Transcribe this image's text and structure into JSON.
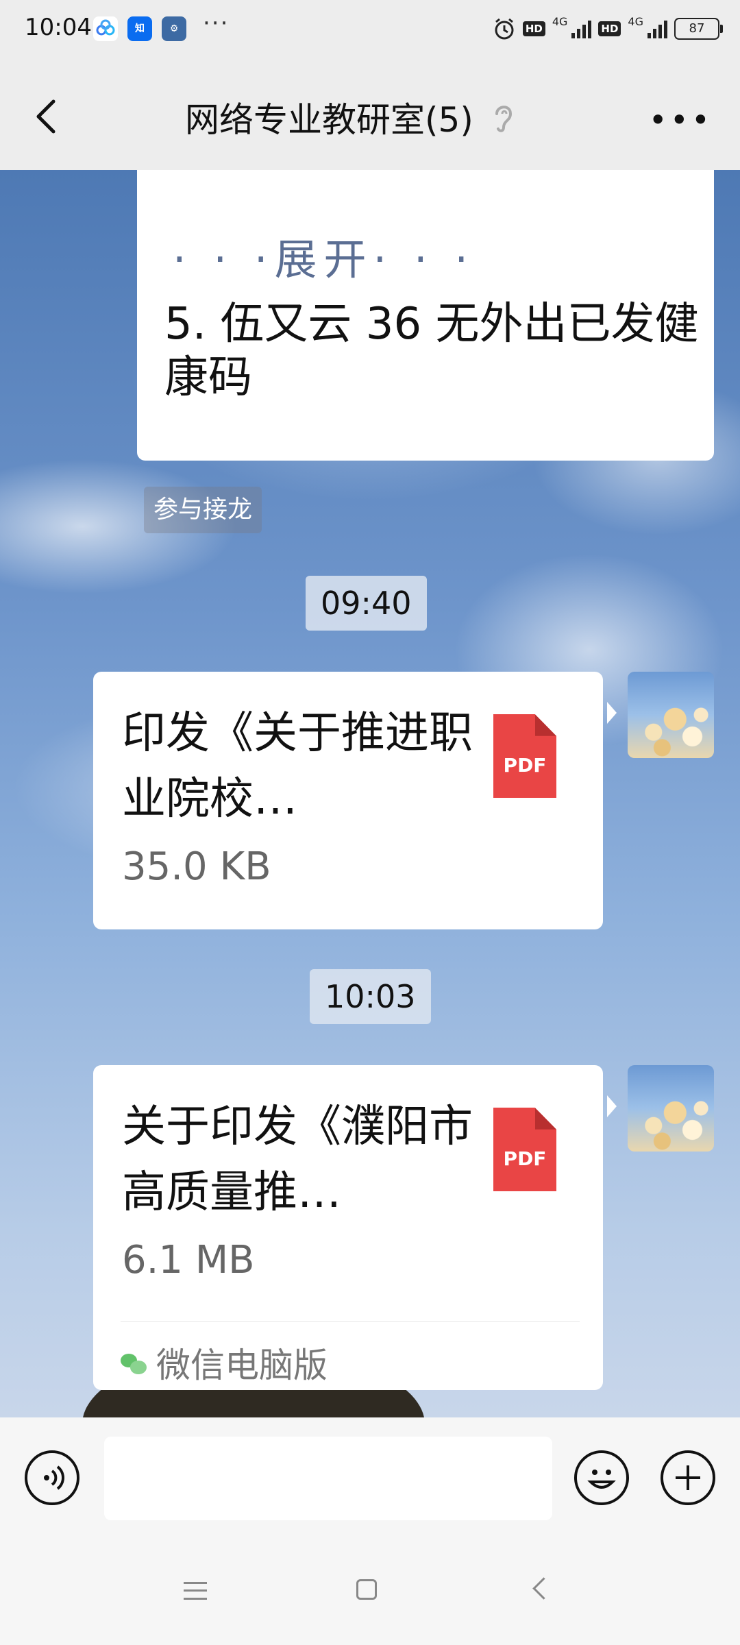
{
  "status_bar": {
    "time": "10:04",
    "apps": [
      "baidu-netdisk",
      "zhihu",
      "settings"
    ],
    "more": "···",
    "network_1": "4G",
    "network_2": "4G",
    "hd_label": "HD",
    "battery": "87"
  },
  "header": {
    "title": "网络专业教研室(5)",
    "back_icon": "chevron-left-icon",
    "mute_icon": "ear-icon",
    "more_icon": "more-horizontal-icon"
  },
  "messages": {
    "solitaire": {
      "expand_label": "· · ·展开· · ·",
      "entry": "5. 伍又云 36 无外出已发健康码",
      "join_label": "参与接龙"
    },
    "time_1": "09:40",
    "file_1": {
      "title": "印发《关于推进职业院校…",
      "size": "35.0 KB",
      "type": "PDF"
    },
    "time_2": "10:03",
    "file_2": {
      "title": "关于印发《濮阳市高质量推…",
      "size": "6.1 MB",
      "type": "PDF",
      "source": "微信电脑版"
    }
  },
  "input_bar": {
    "voice_icon": "voice-icon",
    "emoji_icon": "emoji-icon",
    "add_icon": "plus-icon",
    "text": ""
  },
  "colors": {
    "pdf_red": "#e94545",
    "expand_link": "#5b6e93",
    "wechat_green": "#62c26a"
  }
}
